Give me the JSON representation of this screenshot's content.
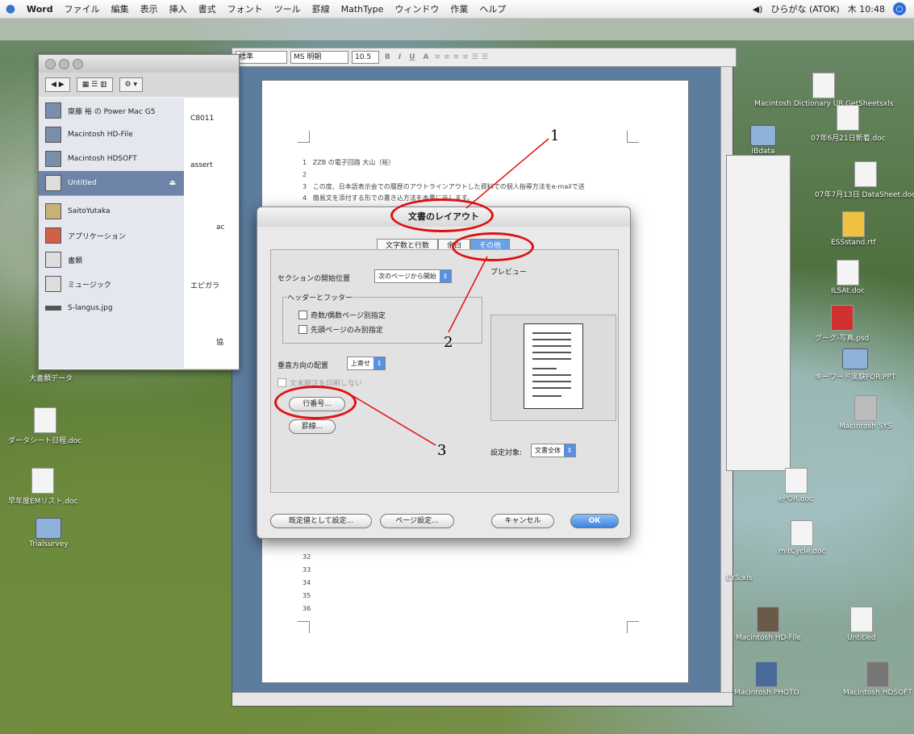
{
  "menubar": {
    "app_name": "Word",
    "items": [
      "ファイル",
      "編集",
      "表示",
      "挿入",
      "書式",
      "フォント",
      "ツール",
      "罫線",
      "MathType",
      "ウィンドウ",
      "作業",
      "ヘルプ"
    ],
    "input_method": "ひらがな (ATOK)",
    "clock": "木 10:48"
  },
  "format_toolbar": {
    "style": "標準",
    "font": "MS 明朝",
    "size": "10.5",
    "buttons": [
      "B",
      "I",
      "U",
      "A"
    ]
  },
  "finder": {
    "sidebar": [
      {
        "label": "齋藤 裕 の Power Mac G5",
        "selected": false
      },
      {
        "label": "Macintosh HD-File",
        "selected": false
      },
      {
        "label": "Macintosh HDSOFT",
        "selected": false
      },
      {
        "label": "Untitled",
        "selected": true
      },
      {
        "label": "SaitoYutaka",
        "selected": false
      },
      {
        "label": "アプリケーション",
        "selected": false
      },
      {
        "label": "書類",
        "selected": false
      },
      {
        "label": "ミュージック",
        "selected": false
      },
      {
        "label": "S-langus.jpg",
        "selected": false
      }
    ],
    "content": [
      "C8011",
      "assert",
      "ac",
      "エピガラ",
      "協"
    ]
  },
  "document": {
    "lines": [
      {
        "n": "1",
        "text": "ZZB の電子回路 大山（裕）"
      },
      {
        "n": "2",
        "text": ""
      },
      {
        "n": "3",
        "text": "この度、日本語表示会での履歴のアウトラインアウトした資料での個人指導方法をe-mailで送"
      },
      {
        "n": "4",
        "text": "簡易文を添付する形での書き込方法を本書に示します。"
      },
      {
        "n": "32",
        "text": ""
      },
      {
        "n": "33",
        "text": ""
      },
      {
        "n": "34",
        "text": ""
      },
      {
        "n": "35",
        "text": ""
      },
      {
        "n": "36",
        "text": ""
      }
    ]
  },
  "dialog": {
    "title": "文書のレイアウト",
    "tabs": [
      "文字数と行数",
      "余白",
      "その他"
    ],
    "active_tab": "その他",
    "section_start_label": "セクションの開始位置",
    "section_start_value": "次のページから開始",
    "header_footer_group": "ヘッダーとフッター",
    "chk_odd_even": "奇数/偶数ページ別指定",
    "chk_first_page": "先頭ページのみ別指定",
    "vertical_align_label": "垂直方向の配置",
    "vertical_align_value": "上寄せ",
    "suppress_endnotes": "文末脚注を印刷しない",
    "line_numbers_button": "行番号...",
    "borders_button": "罫線...",
    "preview_label": "プレビュー",
    "apply_to_label": "設定対象:",
    "apply_to_value": "文書全体",
    "default_button": "既定値として設定...",
    "page_setup_button": "ページ設定...",
    "cancel_button": "キャンセル",
    "ok_button": "OK"
  },
  "annotations": {
    "n1": "1",
    "n2": "2",
    "n3": "3"
  },
  "desktop_icons": [
    "Macintosh Dictionary UR.GetSheetsxls",
    "07年6月21日新着.doc",
    "IBdata",
    "07年7月13日 DataSheet.doc",
    "ESSstand.rtf",
    "ILSAt.doc",
    "グーグ-写真.psd",
    "キーワード実験FOR.PPT",
    "Macintosh SYS",
    "大書類データ",
    "ダータシート日程.doc",
    "早年度EMリスト.doc",
    "Trialsurvey",
    "Macintosh HD-File",
    "Untitled",
    "Macintosh PHOTO",
    "Macintosh HDSOFT",
    "ePOR.doc",
    "EPSCs.doc",
    "mitCycle.doc",
    "EYS.xls"
  ],
  "colors": {
    "annotation_red": "#e01010",
    "selection_blue": "#6d84a8",
    "ok_blue": "#3c82df"
  }
}
